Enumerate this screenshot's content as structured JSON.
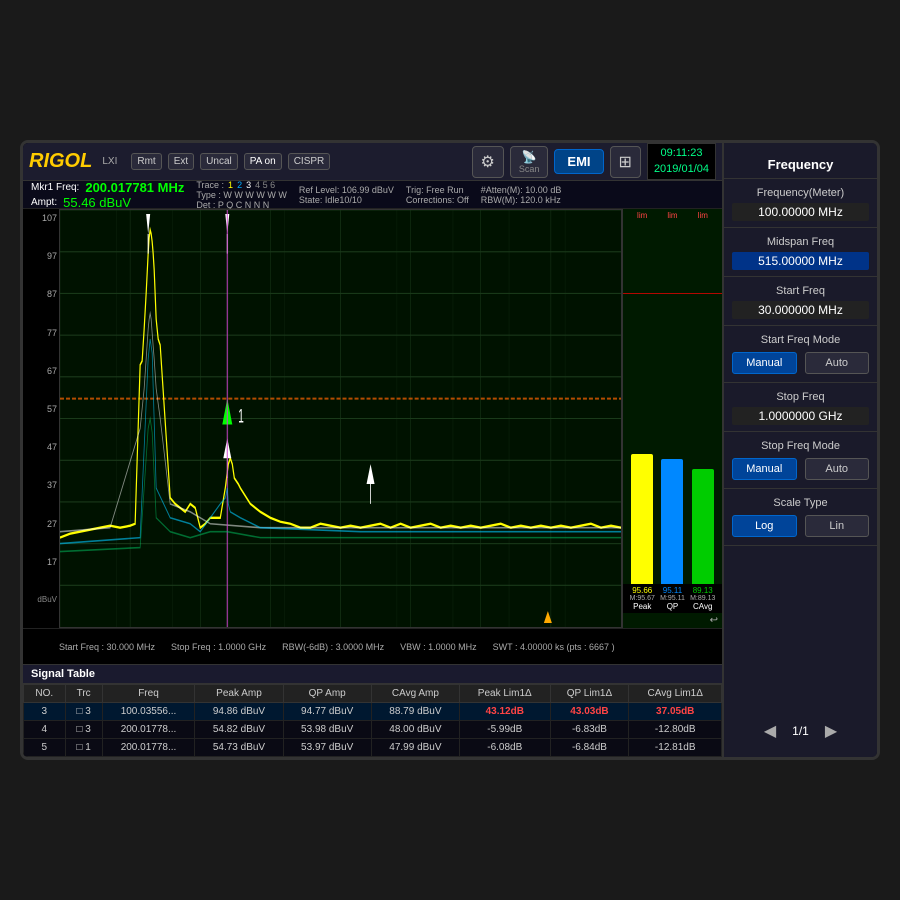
{
  "device": {
    "logo": "RIGOL",
    "logo_sub": "LXI"
  },
  "toolbar": {
    "badges": [
      "Rmt",
      "Ext",
      "Uncal",
      "PA on",
      "CISPR"
    ],
    "buttons": [
      {
        "label": "⚙",
        "sub": "",
        "name": "settings"
      },
      {
        "label": "📡",
        "sub": "Scan",
        "name": "scan"
      },
      {
        "label": "EMI",
        "name": "emi"
      },
      {
        "label": "⊞",
        "name": "layout"
      }
    ],
    "clock": "09:11:23",
    "date": "2019/01/04"
  },
  "info_bar": {
    "mkr_label": "Mkr1 Freq:",
    "mkr_freq": "200.017781 MHz",
    "mkr_ampt_label": "Ampt:",
    "mkr_ampt": "55.46 dBuV",
    "trace_label": "Trace :",
    "trace_nums": [
      "1",
      "2",
      "3",
      "4",
      "5",
      "6"
    ],
    "type_label": "Type :",
    "type_vals": [
      "W",
      "W",
      "W",
      "W",
      "W",
      "W"
    ],
    "det_label": "Det :",
    "det_vals": [
      "P",
      "Q",
      "C",
      "N",
      "N",
      "N"
    ],
    "ref_level": "Ref Level: 106.99 dBuV",
    "state": "State: Idle10/10",
    "trig": "Trig: Free Run",
    "corrections": "Corrections: Off",
    "atten_m": "#Atten(M): 10.00 dB",
    "rbw_m": "RBW(M): 120.0 kHz"
  },
  "chart": {
    "y_labels": [
      "107",
      "97",
      "87",
      "77",
      "67",
      "57",
      "47",
      "37",
      "27",
      "17"
    ],
    "y_unit": "dBuV",
    "foot_start_freq": "Start Freq : 30.000 MHz",
    "foot_rbw": "RBW(-6dB) : 3.0000 MHz",
    "foot_vbw": "VBW : 1.0000 MHz",
    "foot_stop_freq": "Stop Freq : 1.0000 GHz",
    "foot_swt": "SWT : 4.00000 ks (pts : 6667 )"
  },
  "bars": {
    "items": [
      {
        "label": "Peak",
        "color": "#ffff00",
        "height_pct": 82,
        "value": "95.66",
        "m_value": "M:95.67"
      },
      {
        "label": "QP",
        "color": "#0088ff",
        "height_pct": 80,
        "value": "95.11",
        "m_value": "M:95.11"
      },
      {
        "label": "CAvg",
        "color": "#00cc00",
        "height_pct": 75,
        "value": "89.13",
        "m_value": "M:89.13"
      }
    ],
    "lim_labels": [
      "lim",
      "lim",
      "lim"
    ]
  },
  "signal_table": {
    "title": "Signal Table",
    "headers": [
      "NO.",
      "Trc",
      "Freq",
      "Peak Amp",
      "QP Amp",
      "CAvg Amp",
      "Peak Lim1Δ",
      "QP Lim1Δ",
      "CAvg Lim1Δ"
    ],
    "rows": [
      {
        "no": "3",
        "trc": "3",
        "freq": "100.03556...",
        "peak_amp": "94.86 dBuV",
        "qp_amp": "94.77 dBuV",
        "cavg_amp": "88.79 dBuV",
        "peak_lim": "43.12dB",
        "qp_lim": "43.03dB",
        "cavg_lim": "37.05dB",
        "over": true
      },
      {
        "no": "4",
        "trc": "3",
        "freq": "200.01778...",
        "peak_amp": "54.82 dBuV",
        "qp_amp": "53.98 dBuV",
        "cavg_amp": "48.00 dBuV",
        "peak_lim": "-5.99dB",
        "qp_lim": "-6.83dB",
        "cavg_lim": "-12.80dB",
        "over": false
      },
      {
        "no": "5",
        "trc": "1",
        "freq": "200.01778...",
        "peak_amp": "54.73 dBuV",
        "qp_amp": "53.97 dBuV",
        "cavg_amp": "47.99 dBuV",
        "peak_lim": "-6.08dB",
        "qp_lim": "-6.84dB",
        "cavg_lim": "-12.81dB",
        "over": false
      }
    ]
  },
  "right_panel": {
    "title": "Frequency",
    "items": [
      {
        "label": "Frequency(Meter)",
        "value": "100.00000 MHz",
        "active": false
      },
      {
        "label": "Midspan Freq",
        "value": "515.00000 MHz",
        "active": true
      },
      {
        "label": "Start Freq",
        "value": "30.000000 MHz",
        "active": false
      },
      {
        "label": "Start Freq Mode",
        "btn_left": "Manual",
        "btn_right": "Auto",
        "btn_active": "left"
      },
      {
        "label": "Stop Freq",
        "value": "1.0000000 GHz",
        "active": false
      },
      {
        "label": "Stop Freq Mode",
        "btn_left": "Manual",
        "btn_right": "Auto",
        "btn_active": "left"
      },
      {
        "label": "Scale Type",
        "btn_left": "Log",
        "btn_right": "Lin",
        "btn_active": "left"
      }
    ],
    "nav_prev": "◀",
    "nav_page": "1/1",
    "nav_next": "▶"
  }
}
